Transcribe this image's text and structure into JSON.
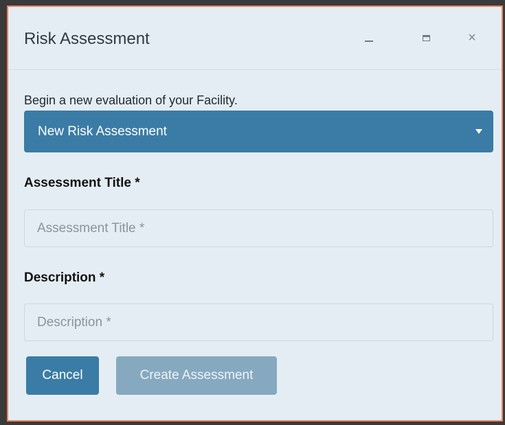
{
  "window": {
    "title": "Risk Assessment",
    "minimize_icon": "minimize-icon",
    "maximize_icon": "maximize-icon",
    "close_icon": "close-icon",
    "close_glyph": "×"
  },
  "form": {
    "intro_text": "Begin a new evaluation of your Facility.",
    "select": {
      "selected_value": "New Risk Assessment",
      "caret_icon": "caret-down-icon"
    },
    "title_field": {
      "label": "Assessment Title *",
      "value": "",
      "placeholder": "Assessment Title *"
    },
    "description_field": {
      "label": "Description *",
      "value": "",
      "placeholder": "Description *"
    }
  },
  "actions": {
    "cancel_label": "Cancel",
    "create_label": "Create Assessment"
  },
  "colors": {
    "accent": "#3a7ca5",
    "disabled_button": "#86a9bf",
    "dialog_border": "#e8835a",
    "dialog_background": "#e4edf3"
  }
}
